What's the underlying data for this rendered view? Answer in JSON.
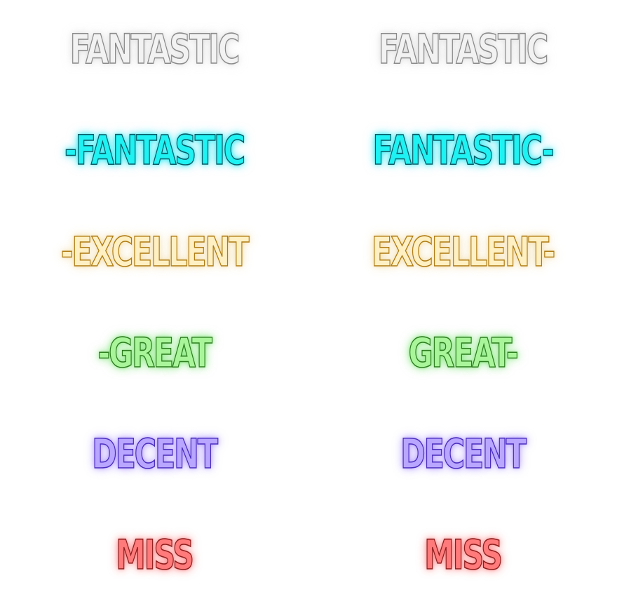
{
  "judgments": [
    {
      "id": "fantastic-white",
      "left": "FANTASTIC",
      "right": "FANTASTIC",
      "fill": "#f2f2f2",
      "stroke": "#8a8a8a",
      "glow": "rgba(200,200,200,0.35)"
    },
    {
      "id": "fantastic-blue",
      "left": "-FANTASTIC",
      "right": "FANTASTIC-",
      "fill": "#1ef2f2",
      "stroke": "#0a5a66",
      "glow": "rgba(0,230,240,0.55)"
    },
    {
      "id": "excellent",
      "left": "-EXCELLENT",
      "right": "EXCELLENT-",
      "fill": "#fff0c4",
      "stroke": "#b07c14",
      "glow": "rgba(240,210,140,0.45)"
    },
    {
      "id": "great",
      "left": "-GREAT",
      "right": "GREAT-",
      "fill": "#a8f59a",
      "stroke": "#2e7d20",
      "glow": "rgba(100,230,90,0.50)"
    },
    {
      "id": "decent",
      "left": "DECENT",
      "right": "DECENT",
      "fill": "#b9a6ff",
      "stroke": "#4a2dbf",
      "glow": "rgba(150,120,255,0.45)"
    },
    {
      "id": "miss",
      "left": "MISS",
      "right": "MISS",
      "fill": "#ff7a7a",
      "stroke": "#8e1d1d",
      "glow": "rgba(255,90,90,0.45)"
    }
  ]
}
